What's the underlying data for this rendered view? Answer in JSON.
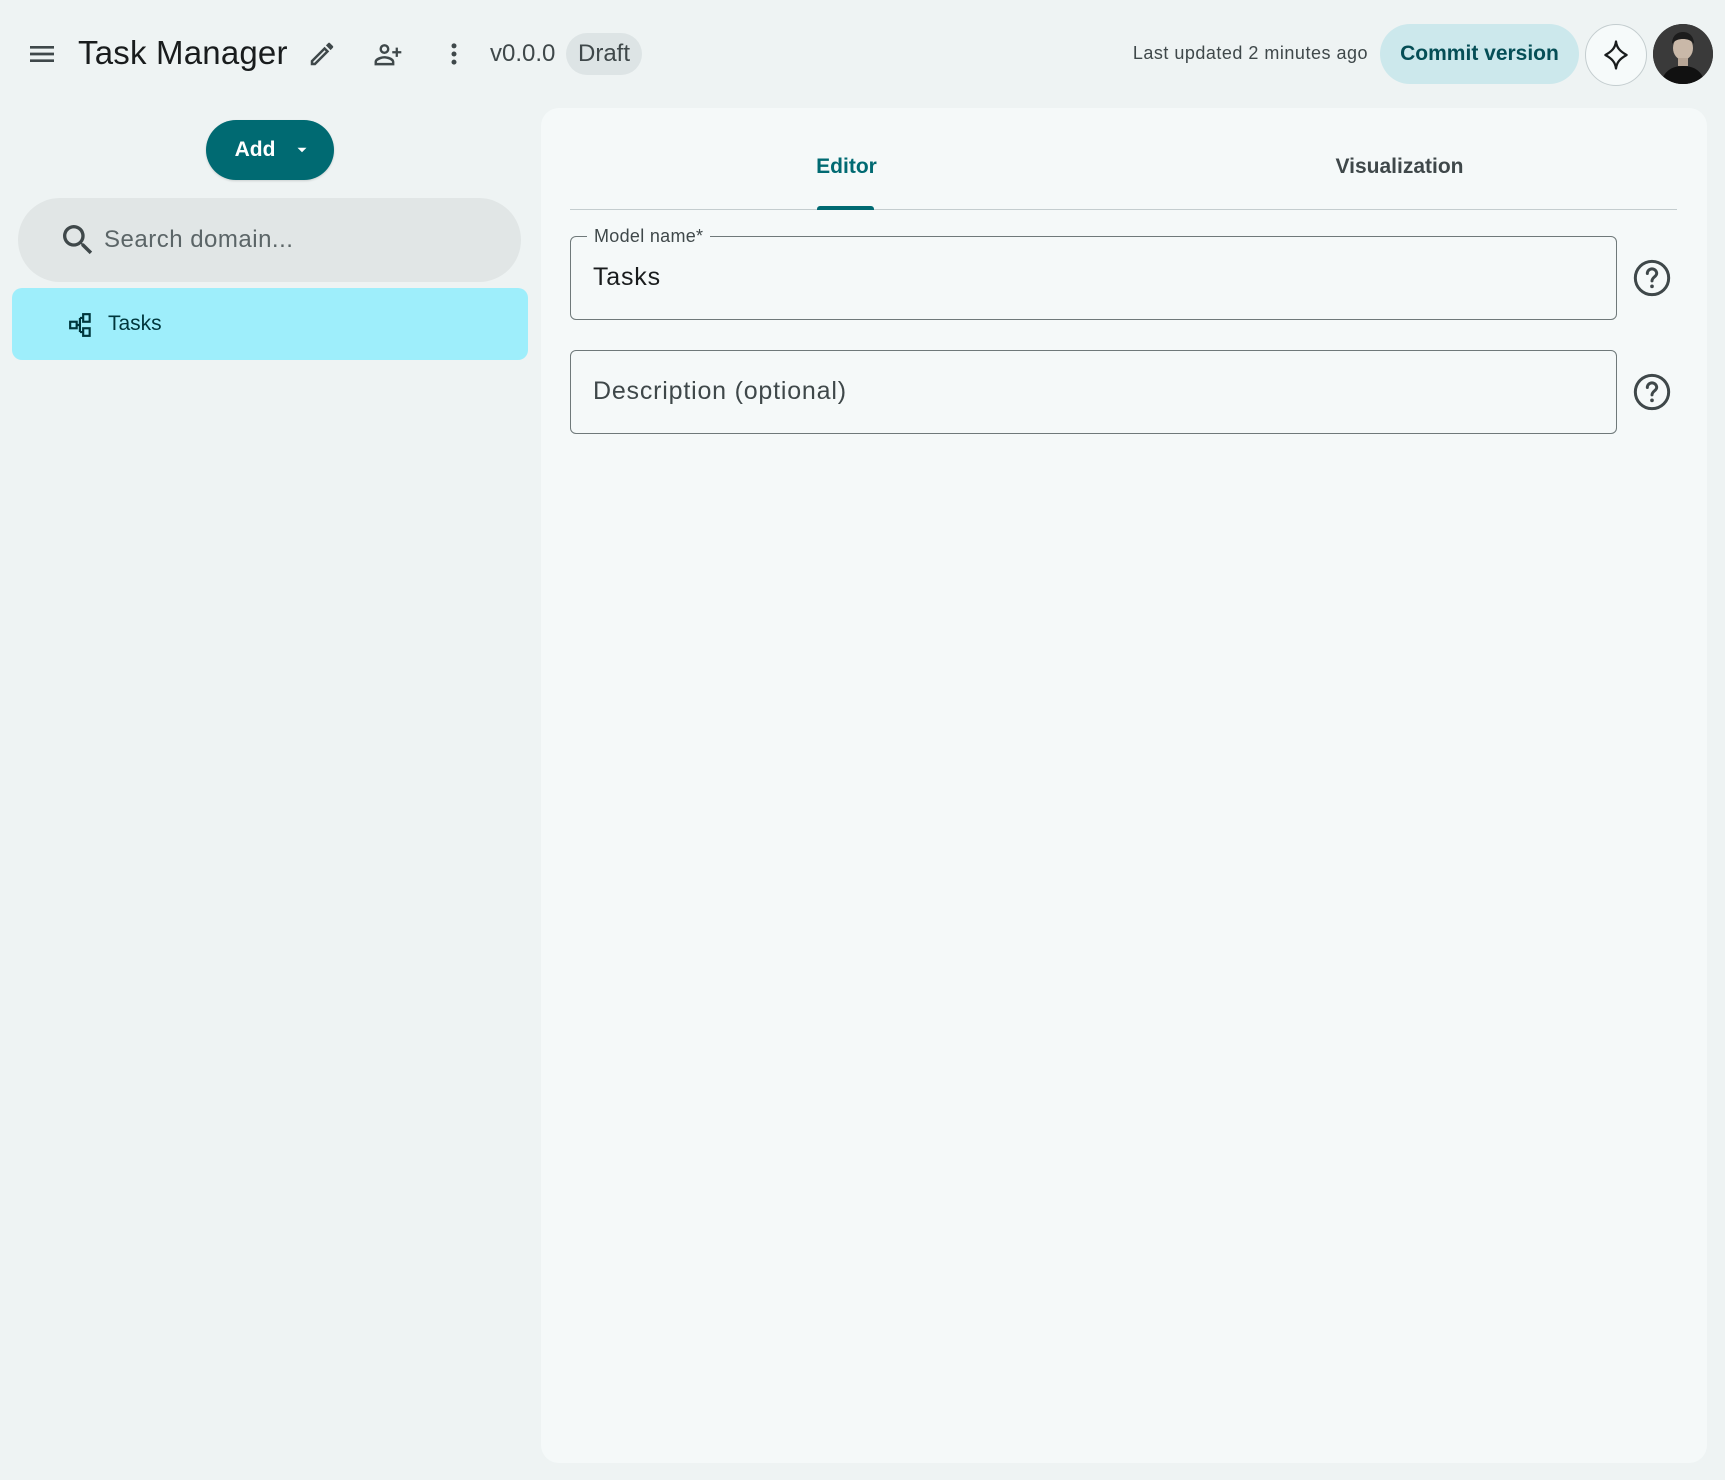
{
  "header": {
    "app_title": "Task Manager",
    "version": "v0.0.0",
    "status": "Draft",
    "last_updated": "Last updated 2 minutes ago",
    "commit_label": "Commit version",
    "icons": [
      "menu-icon",
      "pencil-icon",
      "person-add-icon",
      "more-vert-icon",
      "sparkle-icon"
    ]
  },
  "sidebar": {
    "add_label": "Add",
    "search": {
      "placeholder": "Search domain...",
      "value": ""
    },
    "items": [
      {
        "label": "Tasks",
        "icon": "model-icon",
        "selected": true
      }
    ]
  },
  "main": {
    "tabs": [
      {
        "label": "Editor",
        "active": true
      },
      {
        "label": "Visualization",
        "active": false
      }
    ],
    "fields": {
      "model_name": {
        "label": "Model name*",
        "value": "Tasks"
      },
      "description": {
        "placeholder": "Description (optional)",
        "value": ""
      }
    }
  },
  "colors": {
    "primary": "#006a72",
    "selected_item": "#9eeefb",
    "commit_button_bg": "#cce8ec",
    "app_bg": "#eef3f3",
    "panel_bg": "#f5f9f9"
  }
}
